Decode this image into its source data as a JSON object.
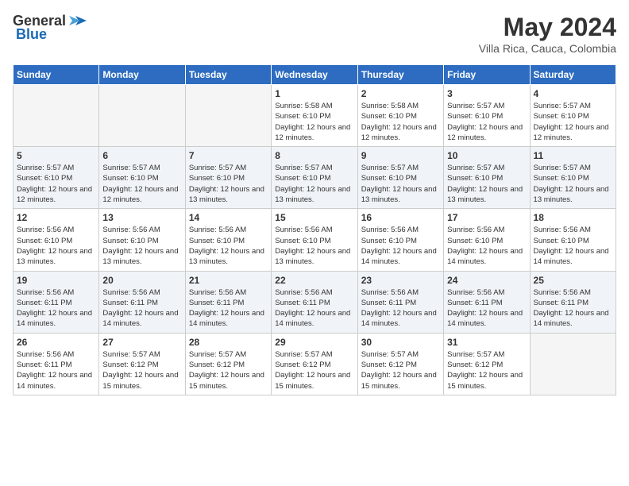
{
  "header": {
    "logo": {
      "general": "General",
      "blue": "Blue"
    },
    "title": "May 2024",
    "location": "Villa Rica, Cauca, Colombia"
  },
  "days_of_week": [
    "Sunday",
    "Monday",
    "Tuesday",
    "Wednesday",
    "Thursday",
    "Friday",
    "Saturday"
  ],
  "weeks": [
    {
      "alt": false,
      "days": [
        {
          "num": "",
          "empty": true
        },
        {
          "num": "",
          "empty": true
        },
        {
          "num": "",
          "empty": true
        },
        {
          "num": "1",
          "sunrise": "5:58 AM",
          "sunset": "6:10 PM",
          "daylight": "12 hours and 12 minutes."
        },
        {
          "num": "2",
          "sunrise": "5:58 AM",
          "sunset": "6:10 PM",
          "daylight": "12 hours and 12 minutes."
        },
        {
          "num": "3",
          "sunrise": "5:57 AM",
          "sunset": "6:10 PM",
          "daylight": "12 hours and 12 minutes."
        },
        {
          "num": "4",
          "sunrise": "5:57 AM",
          "sunset": "6:10 PM",
          "daylight": "12 hours and 12 minutes."
        }
      ]
    },
    {
      "alt": true,
      "days": [
        {
          "num": "5",
          "sunrise": "5:57 AM",
          "sunset": "6:10 PM",
          "daylight": "12 hours and 12 minutes."
        },
        {
          "num": "6",
          "sunrise": "5:57 AM",
          "sunset": "6:10 PM",
          "daylight": "12 hours and 12 minutes."
        },
        {
          "num": "7",
          "sunrise": "5:57 AM",
          "sunset": "6:10 PM",
          "daylight": "12 hours and 13 minutes."
        },
        {
          "num": "8",
          "sunrise": "5:57 AM",
          "sunset": "6:10 PM",
          "daylight": "12 hours and 13 minutes."
        },
        {
          "num": "9",
          "sunrise": "5:57 AM",
          "sunset": "6:10 PM",
          "daylight": "12 hours and 13 minutes."
        },
        {
          "num": "10",
          "sunrise": "5:57 AM",
          "sunset": "6:10 PM",
          "daylight": "12 hours and 13 minutes."
        },
        {
          "num": "11",
          "sunrise": "5:57 AM",
          "sunset": "6:10 PM",
          "daylight": "12 hours and 13 minutes."
        }
      ]
    },
    {
      "alt": false,
      "days": [
        {
          "num": "12",
          "sunrise": "5:56 AM",
          "sunset": "6:10 PM",
          "daylight": "12 hours and 13 minutes."
        },
        {
          "num": "13",
          "sunrise": "5:56 AM",
          "sunset": "6:10 PM",
          "daylight": "12 hours and 13 minutes."
        },
        {
          "num": "14",
          "sunrise": "5:56 AM",
          "sunset": "6:10 PM",
          "daylight": "12 hours and 13 minutes."
        },
        {
          "num": "15",
          "sunrise": "5:56 AM",
          "sunset": "6:10 PM",
          "daylight": "12 hours and 13 minutes."
        },
        {
          "num": "16",
          "sunrise": "5:56 AM",
          "sunset": "6:10 PM",
          "daylight": "12 hours and 14 minutes."
        },
        {
          "num": "17",
          "sunrise": "5:56 AM",
          "sunset": "6:10 PM",
          "daylight": "12 hours and 14 minutes."
        },
        {
          "num": "18",
          "sunrise": "5:56 AM",
          "sunset": "6:10 PM",
          "daylight": "12 hours and 14 minutes."
        }
      ]
    },
    {
      "alt": true,
      "days": [
        {
          "num": "19",
          "sunrise": "5:56 AM",
          "sunset": "6:11 PM",
          "daylight": "12 hours and 14 minutes."
        },
        {
          "num": "20",
          "sunrise": "5:56 AM",
          "sunset": "6:11 PM",
          "daylight": "12 hours and 14 minutes."
        },
        {
          "num": "21",
          "sunrise": "5:56 AM",
          "sunset": "6:11 PM",
          "daylight": "12 hours and 14 minutes."
        },
        {
          "num": "22",
          "sunrise": "5:56 AM",
          "sunset": "6:11 PM",
          "daylight": "12 hours and 14 minutes."
        },
        {
          "num": "23",
          "sunrise": "5:56 AM",
          "sunset": "6:11 PM",
          "daylight": "12 hours and 14 minutes."
        },
        {
          "num": "24",
          "sunrise": "5:56 AM",
          "sunset": "6:11 PM",
          "daylight": "12 hours and 14 minutes."
        },
        {
          "num": "25",
          "sunrise": "5:56 AM",
          "sunset": "6:11 PM",
          "daylight": "12 hours and 14 minutes."
        }
      ]
    },
    {
      "alt": false,
      "days": [
        {
          "num": "26",
          "sunrise": "5:56 AM",
          "sunset": "6:11 PM",
          "daylight": "12 hours and 14 minutes."
        },
        {
          "num": "27",
          "sunrise": "5:57 AM",
          "sunset": "6:12 PM",
          "daylight": "12 hours and 15 minutes."
        },
        {
          "num": "28",
          "sunrise": "5:57 AM",
          "sunset": "6:12 PM",
          "daylight": "12 hours and 15 minutes."
        },
        {
          "num": "29",
          "sunrise": "5:57 AM",
          "sunset": "6:12 PM",
          "daylight": "12 hours and 15 minutes."
        },
        {
          "num": "30",
          "sunrise": "5:57 AM",
          "sunset": "6:12 PM",
          "daylight": "12 hours and 15 minutes."
        },
        {
          "num": "31",
          "sunrise": "5:57 AM",
          "sunset": "6:12 PM",
          "daylight": "12 hours and 15 minutes."
        },
        {
          "num": "",
          "empty": true
        }
      ]
    }
  ]
}
